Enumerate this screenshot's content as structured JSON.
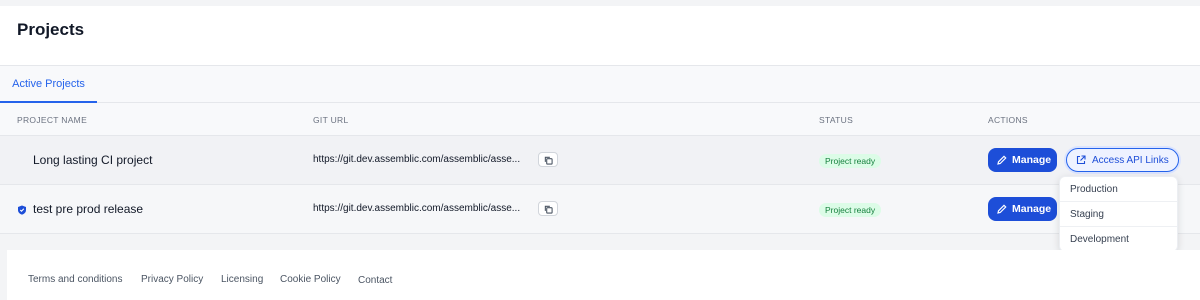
{
  "header": {
    "title": "Projects"
  },
  "tabs": [
    {
      "label": "Active Projects"
    }
  ],
  "table": {
    "columns": [
      "PROJECT NAME",
      "GIT URL",
      "STATUS",
      "ACTIONS"
    ],
    "rows": [
      {
        "name": "Long lasting CI project",
        "url": "https://git.dev.assemblic.com/assemblic/asse...",
        "status": "Project ready",
        "manage_label": "Manage",
        "api_label": "Access API Links"
      },
      {
        "name": "test pre prod release",
        "url": "https://git.dev.assemblic.com/assemblic/asse...",
        "status": "Project ready",
        "manage_label": "Manage",
        "icon": "shield-icon"
      }
    ]
  },
  "dropdown": {
    "items": [
      "Production",
      "Staging",
      "Development"
    ]
  },
  "footer": {
    "links": [
      "Terms and conditions",
      "Privacy Policy",
      "Licensing",
      "Cookie Policy",
      "Contact"
    ]
  },
  "colors": {
    "primary": "#1d4ed8",
    "accent": "#2563eb",
    "status_bg": "#dcfce7",
    "status_text": "#15803d"
  }
}
